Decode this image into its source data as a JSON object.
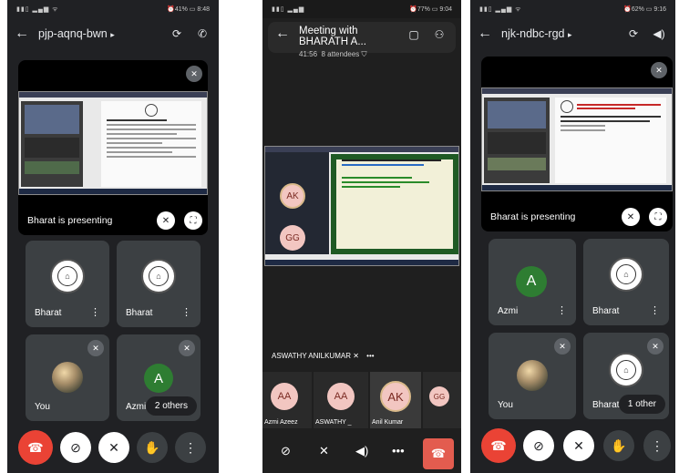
{
  "phone1": {
    "status": {
      "left": "▮▮▯ ▂▄▆ ᯤ",
      "right": "⏰41% ▭ 8:48"
    },
    "meeting_code": "pjp-aqnq-bwn",
    "code_caret": "▸",
    "presenting_label": "Bharat is presenting",
    "tiles": [
      {
        "name": "Bharat",
        "type": "logo"
      },
      {
        "name": "Bharat",
        "type": "logo"
      },
      {
        "name": "You",
        "type": "photo"
      },
      {
        "name": "Azmi",
        "type": "letter",
        "letter": "A",
        "extra": "2 others"
      }
    ],
    "more_label": "⋮"
  },
  "phone2": {
    "status": {
      "left": "▮▮▯ ▂▄▆",
      "right": "⏰77% ▭ 9:04"
    },
    "title": "Meeting with BHARATH A...",
    "elapsed": "41:56",
    "attendees": "8 attendees",
    "screen_avatars": [
      "AK",
      "GG"
    ],
    "pinned_name": "ASWATHY ANILKUMAR",
    "pinned_more": "•••",
    "strip": [
      {
        "initials": "AA",
        "name": "Azmi Azeez"
      },
      {
        "initials": "AA",
        "name": "ASWATHY _"
      },
      {
        "initials": "AK",
        "name": "Anil Kumar"
      },
      {
        "initials": "GG",
        "name": ""
      }
    ],
    "more_label": "•••"
  },
  "phone3": {
    "status": {
      "left": "▮▮▯ ▂▄▆ ᯤ",
      "right": "⏰62% ▭ 9:16"
    },
    "meeting_code": "njk-ndbc-rgd",
    "code_caret": "▸",
    "presenting_label": "Bharat is presenting",
    "tiles": [
      {
        "name": "Azmi",
        "type": "letter",
        "letter": "A"
      },
      {
        "name": "Bharat",
        "type": "logo"
      },
      {
        "name": "You",
        "type": "photo"
      },
      {
        "name": "Bharat",
        "type": "logo",
        "extra": "1 other"
      }
    ],
    "more_label": "⋮"
  },
  "colors": {
    "meet_bg": "#202124",
    "tile_bg": "#3c4043",
    "end_call": "#ea4335",
    "avatar_green": "#2e7d32",
    "avatar_pink": "#f2c6c1"
  }
}
